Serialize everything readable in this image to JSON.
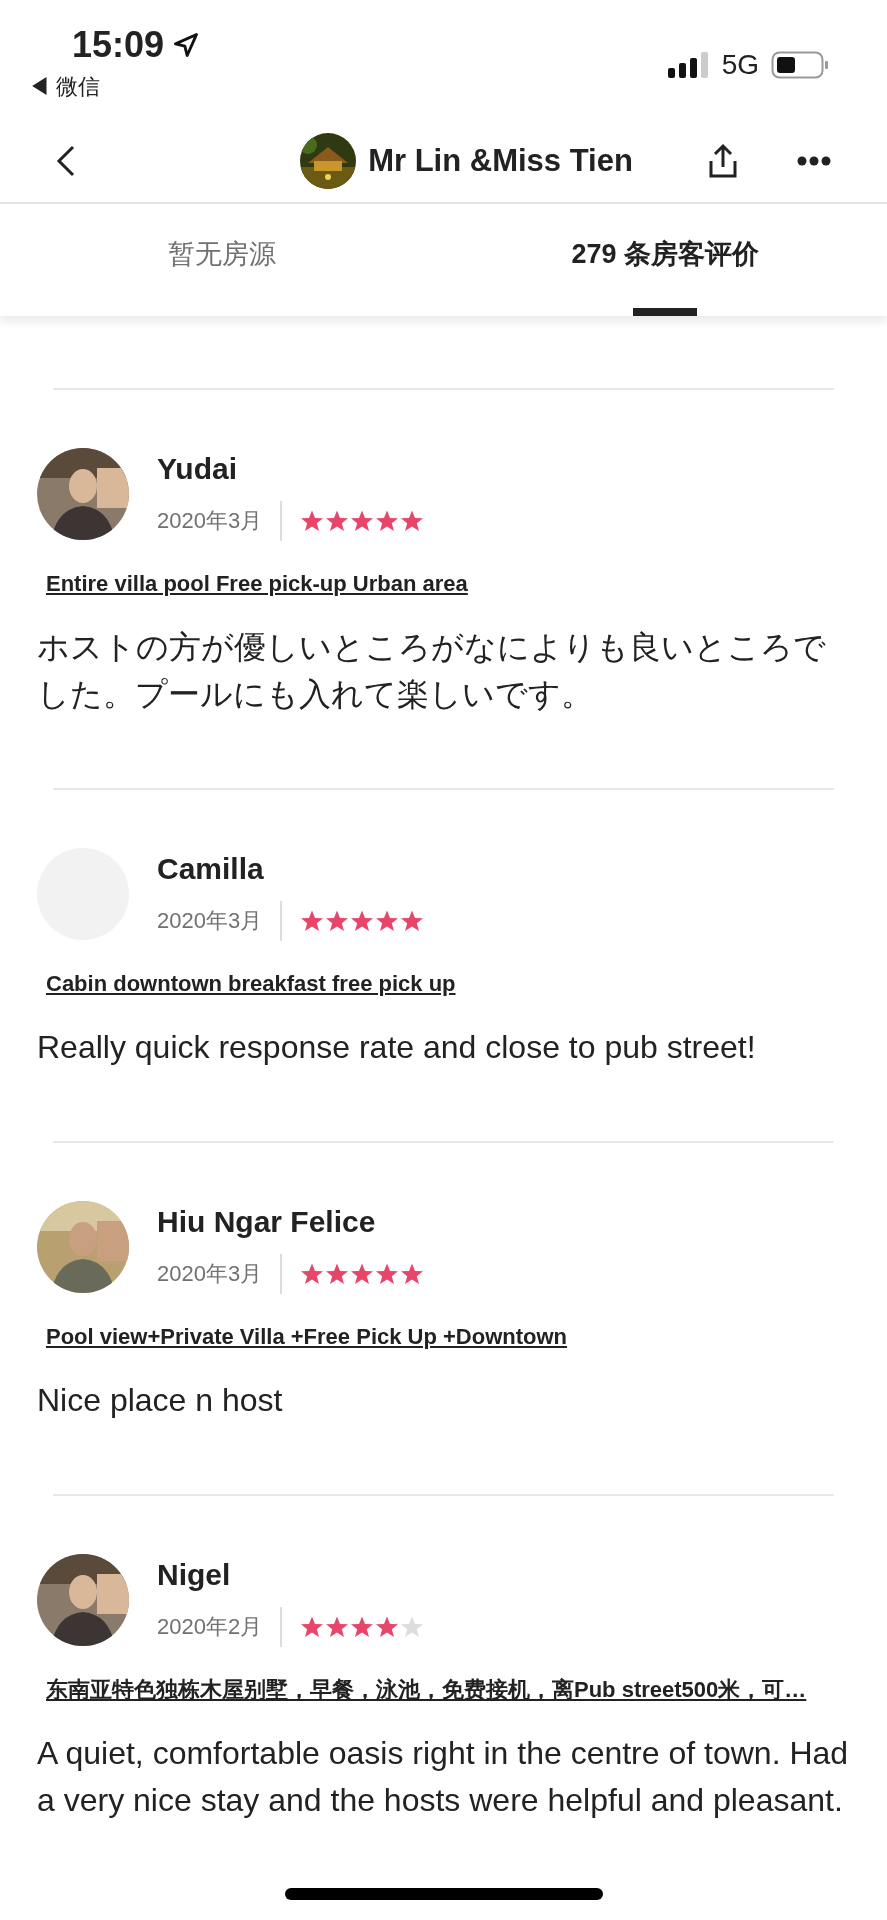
{
  "status_bar": {
    "time": "15:09",
    "back_app": "◀ 微信",
    "network": "5G"
  },
  "header": {
    "title": "Mr Lin &Miss Tien"
  },
  "tabs": [
    {
      "label": "暂无房源",
      "selected": false
    },
    {
      "label": "279 条房客评价",
      "selected": true
    }
  ],
  "reviews": [
    {
      "name": "Yudai",
      "date": "2020年3月",
      "stars": 5,
      "listing": "Entire villa pool Free pick-up Urban area",
      "text": "ホストの方が優しいところがなによりも良いところでした。プールにも入れて楽しいです。"
    },
    {
      "name": "Camilla",
      "avatar": {
        "kind": "blank"
      },
      "date": "2020年3月",
      "stars": 5,
      "listing": "Cabin downtown breakfast free pick up",
      "text": "Really quick response rate and close to pub street!"
    },
    {
      "name": "Hiu Ngar Felice",
      "date": "2020年3月",
      "stars": 5,
      "listing": "Pool view+Private Villa +Free Pick Up +Downtown",
      "text": "Nice place n host"
    },
    {
      "name": "Nigel",
      "date": "2020年2月",
      "stars": 4,
      "listing": "东南亚特色独栋木屋别墅，早餐，泳池，免费接机，离Pub street500米，可…",
      "text": "A quiet, comfortable oasis right in the centre of town. Had a very nice stay and the hosts were helpful and pleasant."
    }
  ]
}
